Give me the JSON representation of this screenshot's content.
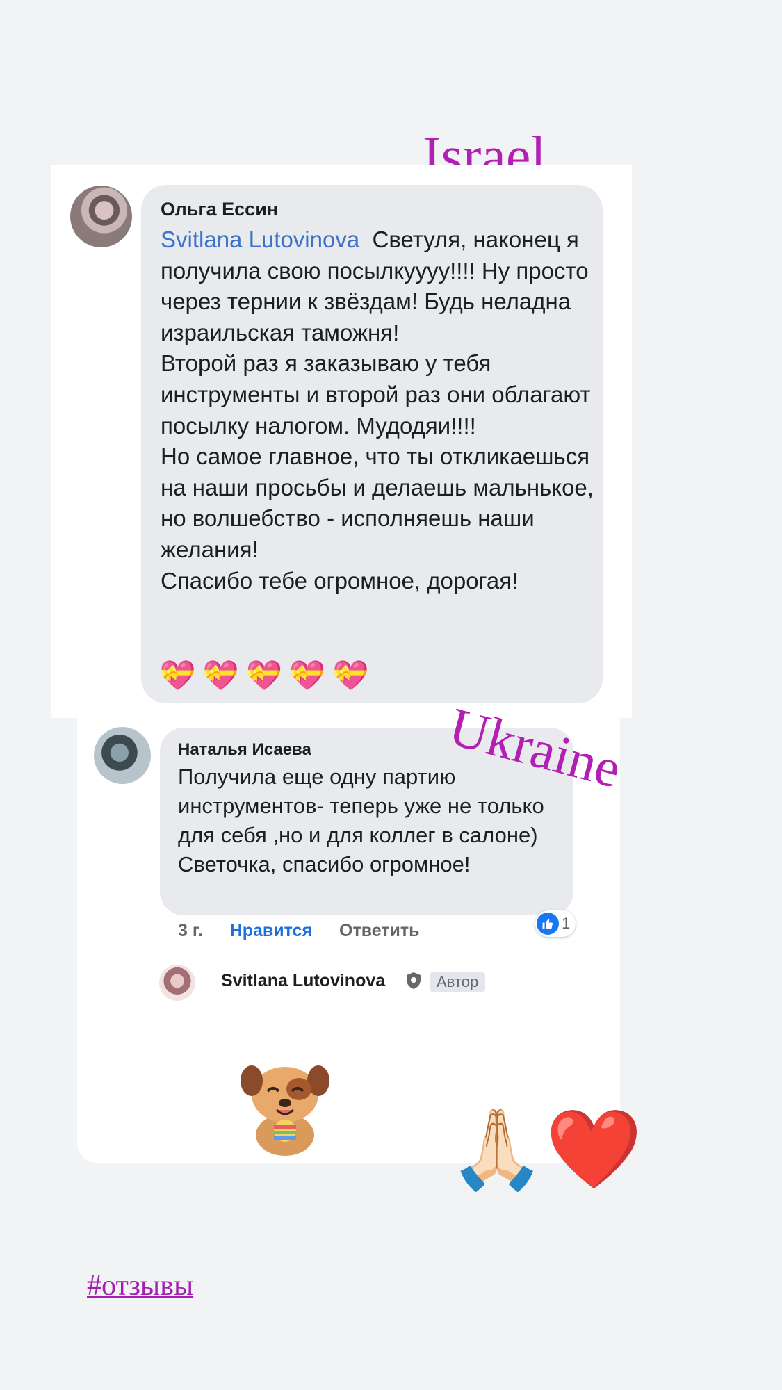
{
  "overlays": {
    "label_israel": "Israel",
    "label_ukraine": "Ukraine",
    "decorative_emoji": "🙏🏻❤️",
    "hashtag": "#отзывы"
  },
  "comment1": {
    "author": "Ольга Ессин",
    "mention": "Svitlana Lutovinova",
    "text": "  Светуля, наконец я получила свою посылкуууу!!!! Ну просто через тернии к звёздам! Будь неладна израильская таможня!\nВторой раз я заказываю у тебя инструменты и второй раз они облагают посылку налогом. Мудодяи!!!!\nНо самое главное, что ты откликаешься на наши просьбы и делаешь мальнькое, но волшебство - исполняешь наши желания!\nСпасибо тебе огромное, дорогая!",
    "emojis": "💝💝💝💝💝"
  },
  "comment2": {
    "author": "Наталья Исаева",
    "text": "Получила еще одну партию инструментов- теперь уже не только для себя ,но и для коллег в салоне)  Светочка, спасибо огромное!",
    "time": "3 г.",
    "like_label": "Нравится",
    "reply_label": "Ответить",
    "like_count": "1"
  },
  "reply": {
    "author": "Svitlana Lutovinova",
    "badge": "Автор",
    "icons": {
      "verified": "shield-icon",
      "sticker": "dog-sticker"
    }
  },
  "colors": {
    "accent_label": "#b21fb4",
    "mention": "#3b73c8",
    "like": "#1877f2"
  }
}
